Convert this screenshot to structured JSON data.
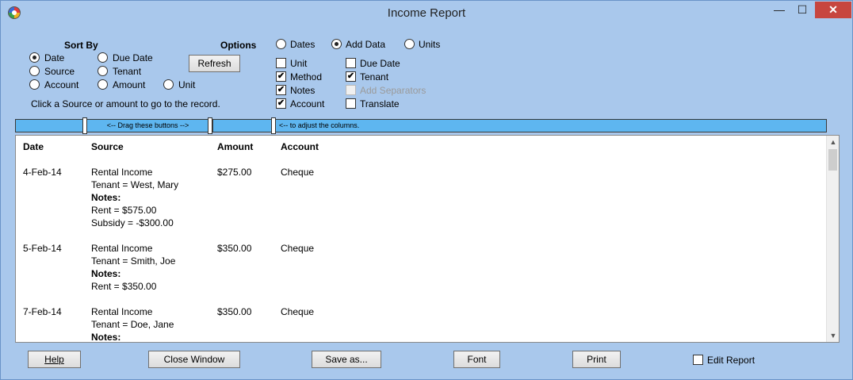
{
  "window": {
    "title": "Income Report",
    "controls": {
      "minimize": "—",
      "maximize": "☐",
      "close": "✕"
    }
  },
  "sort_by": {
    "heading": "Sort By",
    "options": [
      {
        "label": "Date",
        "checked": true
      },
      {
        "label": "Due Date",
        "checked": false
      },
      {
        "label": "Source",
        "checked": false
      },
      {
        "label": "Tenant",
        "checked": false
      },
      {
        "label": "Account",
        "checked": false
      },
      {
        "label": "Amount",
        "checked": false
      },
      {
        "label": "Unit",
        "checked": false
      }
    ]
  },
  "refresh_label": "Refresh",
  "hint": "Click a Source or amount to go to the record.",
  "options": {
    "heading": "Options",
    "modes": [
      {
        "label": "Dates",
        "checked": false
      },
      {
        "label": "Add Data",
        "checked": true
      },
      {
        "label": "Units",
        "checked": false
      }
    ],
    "checks": [
      {
        "label": "Unit",
        "checked": false,
        "enabled": true
      },
      {
        "label": "Due Date",
        "checked": false,
        "enabled": true
      },
      {
        "label": "Method",
        "checked": true,
        "enabled": true
      },
      {
        "label": "Tenant",
        "checked": true,
        "enabled": true
      },
      {
        "label": "Notes",
        "checked": true,
        "enabled": true
      },
      {
        "label": "Add Separators",
        "checked": false,
        "enabled": false
      },
      {
        "label": "Account",
        "checked": true,
        "enabled": true
      },
      {
        "label": "Translate",
        "checked": false,
        "enabled": true
      }
    ],
    "check_mark": "✔"
  },
  "column_bar": {
    "drag_text": "<-- Drag these buttons -->",
    "adjust_text": "<-- to adjust the columns."
  },
  "report": {
    "headers": [
      "Date",
      "Source",
      "Amount",
      "Account"
    ],
    "records": [
      {
        "date": "4-Feb-14",
        "source": "Rental Income",
        "amount": "$275.00",
        "account": "Cheque",
        "tenant": "Tenant = West, Mary",
        "notes_label": "Notes:",
        "notes": [
          "Rent = $575.00",
          "Subsidy = -$300.00"
        ]
      },
      {
        "date": "5-Feb-14",
        "source": "Rental Income",
        "amount": "$350.00",
        "account": "Cheque",
        "tenant": "Tenant = Smith, Joe",
        "notes_label": "Notes:",
        "notes": [
          "Rent = $350.00"
        ]
      },
      {
        "date": "7-Feb-14",
        "source": "Rental Income",
        "amount": "$350.00",
        "account": "Cheque",
        "tenant": "Tenant = Doe, Jane",
        "notes_label": "Notes:",
        "notes": []
      }
    ],
    "scroll_up": "▲",
    "scroll_down": "▼"
  },
  "footer": {
    "help": "Help",
    "close_window": "Close Window",
    "save_as": "Save as...",
    "font": "Font",
    "print": "Print",
    "edit_report": "Edit Report"
  }
}
